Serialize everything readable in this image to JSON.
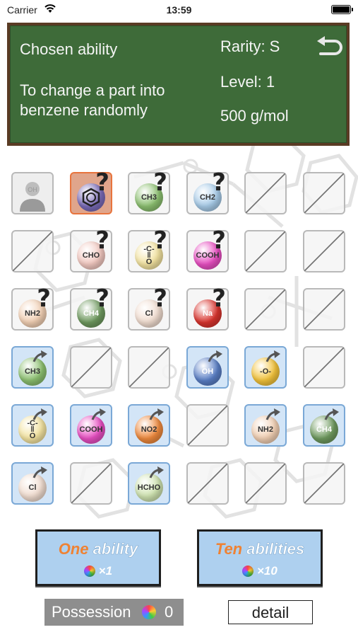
{
  "status_bar": {
    "carrier": "Carrier",
    "time": "13:59"
  },
  "board": {
    "title": "Chosen ability",
    "description": "To change a part into benzene randomly",
    "rarity": "Rarity: S",
    "level": "Level: 1",
    "weight": "500 g/mol"
  },
  "cells": [
    {
      "kind": "avatar"
    },
    {
      "kind": "unknown",
      "label": "",
      "color": "#7a6bb8",
      "benzene": true,
      "selected": true
    },
    {
      "kind": "unknown",
      "label": "CH3",
      "color": "#8cc070"
    },
    {
      "kind": "unknown",
      "label": "CH2",
      "color": "#a7cbe8"
    },
    {
      "kind": "empty"
    },
    {
      "kind": "empty"
    },
    {
      "kind": "empty"
    },
    {
      "kind": "unknown",
      "label": "CHO",
      "color": "#f2c8c0"
    },
    {
      "kind": "unknown",
      "label": "-C-\n‖\nO",
      "color": "#f3e3a0"
    },
    {
      "kind": "unknown",
      "label": "COOH",
      "color": "#e84fc2"
    },
    {
      "kind": "empty"
    },
    {
      "kind": "empty"
    },
    {
      "kind": "unknown",
      "label": "NH2",
      "color": "#f1cfb3"
    },
    {
      "kind": "unknown",
      "label": "CH4",
      "color": "#6f9a5f"
    },
    {
      "kind": "unknown",
      "label": "Cl",
      "color": "#f1ddd0"
    },
    {
      "kind": "unknown",
      "label": "Na",
      "color": "#d9342e"
    },
    {
      "kind": "empty"
    },
    {
      "kind": "empty"
    },
    {
      "kind": "owned",
      "label": "CH3",
      "color": "#8cc070"
    },
    {
      "kind": "empty"
    },
    {
      "kind": "empty"
    },
    {
      "kind": "owned",
      "label": "OH",
      "color": "#5a7fc6"
    },
    {
      "kind": "owned",
      "label": "-O-",
      "color": "#f3c33b"
    },
    {
      "kind": "empty"
    },
    {
      "kind": "owned",
      "label": "-C-\n‖\nO",
      "color": "#f3e3a0"
    },
    {
      "kind": "owned",
      "label": "COOH",
      "color": "#e84fc2"
    },
    {
      "kind": "owned",
      "label": "NO2",
      "color": "#ef8a3e"
    },
    {
      "kind": "empty"
    },
    {
      "kind": "owned",
      "label": "NH2",
      "color": "#f1cfb3"
    },
    {
      "kind": "owned",
      "label": "CH4",
      "color": "#6f9a5f"
    },
    {
      "kind": "owned",
      "label": "Cl",
      "color": "#f1ddd0"
    },
    {
      "kind": "empty"
    },
    {
      "kind": "owned",
      "label": "HCHO",
      "color": "#cfe3b0"
    },
    {
      "kind": "empty"
    },
    {
      "kind": "empty"
    },
    {
      "kind": "empty"
    }
  ],
  "buttons": {
    "one": {
      "title_a": "One",
      "title_b": " ability",
      "cost": "×1"
    },
    "ten": {
      "title_a": "Ten",
      "title_b": " abilities",
      "cost": "×10"
    }
  },
  "possession": {
    "label": "Possession",
    "count": "0"
  },
  "detail_label": "detail"
}
